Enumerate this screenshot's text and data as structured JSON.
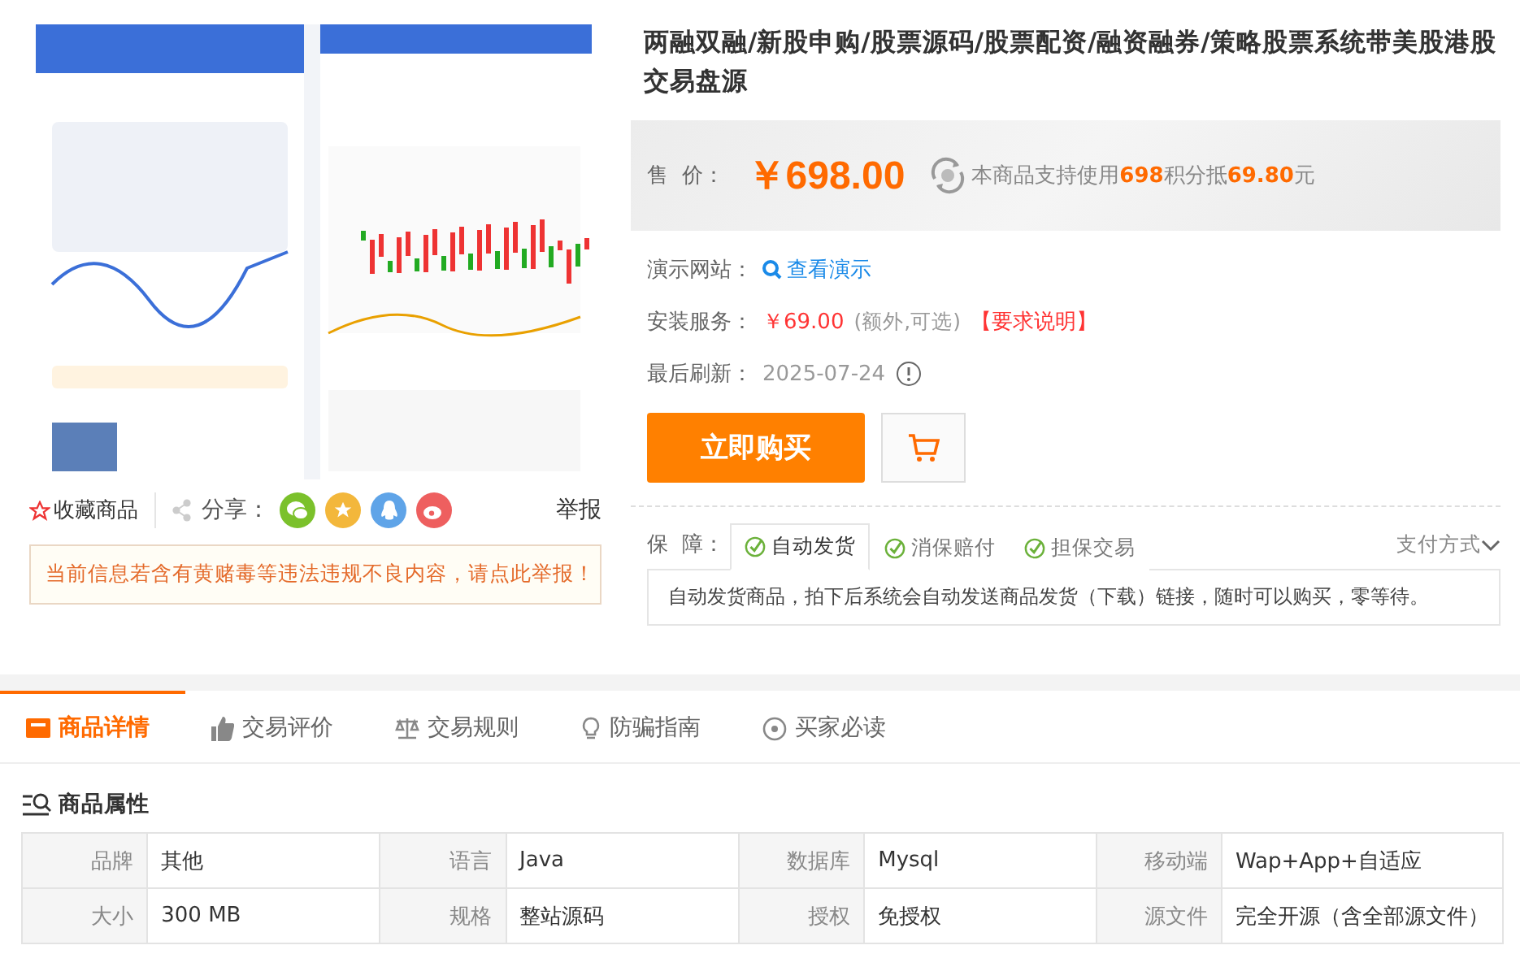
{
  "product": {
    "title": "两融双融/新股申购/股票源码/股票配资/融资融券/策略股票系统带美股港股交易盘源",
    "price": {
      "label": "售  价：",
      "amount": "￥698.00",
      "points_note": "本商品支持使用**698**积分抵**69.80**元"
    },
    "info": [
      {
        "kind": "demo",
        "label": "演示网站：",
        "value": "查看演示"
      },
      {
        "kind": "install",
        "label": "安装服务：",
        "value": "￥69.00",
        "note": "(额外,可选)",
        "link": "【要求说明】"
      },
      {
        "kind": "refresh",
        "label": "最后刷新：",
        "value": "2025-07-24"
      }
    ],
    "buy_button": "立即购买",
    "guarantee": {
      "label": "保  障：",
      "tabs": [
        {
          "label": "自动发货",
          "selected": true
        },
        {
          "label": "消保赔付",
          "selected": false
        },
        {
          "label": "担保交易",
          "selected": false
        }
      ],
      "payment": "支付方式",
      "description": "自动发货商品，拍下后系统会自动发送商品发货（下载）链接，随时可以购买，零等待。"
    },
    "favorite": "收藏商品",
    "share_label": "分享：",
    "report": "举报",
    "notice": "当前信息若含有黄赌毒等违法违规不良内容，请点此举报！"
  },
  "tabs": [
    {
      "label": "商品详情",
      "selected": true
    },
    {
      "label": "交易评价",
      "selected": false
    },
    {
      "label": "交易规则",
      "selected": false
    },
    {
      "label": "防骗指南",
      "selected": false
    },
    {
      "label": "买家必读",
      "selected": false
    }
  ],
  "attributes": {
    "title": "商品属性",
    "rows": [
      [
        {
          "name": "品牌",
          "value": "其他"
        },
        {
          "name": "语言",
          "value": "Java"
        },
        {
          "name": "数据库",
          "value": "Mysql"
        },
        {
          "name": "移动端",
          "value": "Wap+App+自适应"
        }
      ],
      [
        {
          "name": "大小",
          "value": "300 MB"
        },
        {
          "name": "规格",
          "value": "整站源码"
        },
        {
          "name": "授权",
          "value": "免授权"
        },
        {
          "name": "源文件",
          "value": "完全开源（含全部源文件）"
        }
      ]
    ]
  }
}
